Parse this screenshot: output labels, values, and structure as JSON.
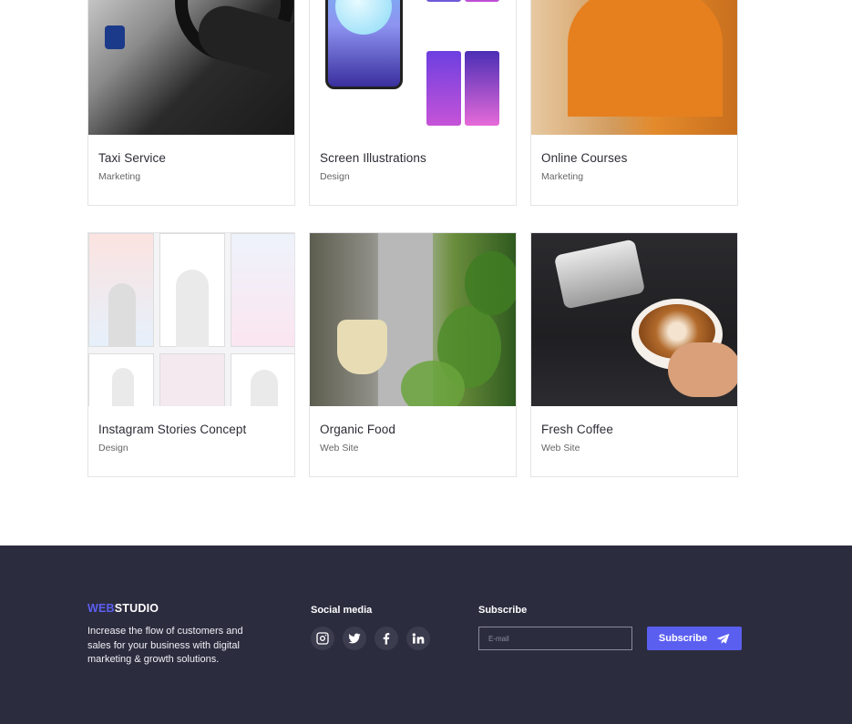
{
  "portfolio": {
    "items": [
      {
        "title": "Taxi Service",
        "category": "Marketing"
      },
      {
        "title": "Screen Illustrations",
        "category": "Design"
      },
      {
        "title": "Online Courses",
        "category": "Marketing"
      },
      {
        "title": "Instagram Stories Concept",
        "category": "Design"
      },
      {
        "title": "Organic Food",
        "category": "Web Site"
      },
      {
        "title": "Fresh Coffee",
        "category": "Web Site"
      }
    ]
  },
  "footer": {
    "brand_accent": "WEB",
    "brand_rest": "STUDIO",
    "description": "Increase the flow of customers and sales for your business with digital marketing & growth solutions.",
    "social_heading": "Social media",
    "social_icons": [
      "instagram-icon",
      "twitter-icon",
      "facebook-icon",
      "linkedin-icon"
    ],
    "subscribe_heading": "Subscribe",
    "email_placeholder": "E-mail",
    "subscribe_button": "Subscribe"
  },
  "colors": {
    "accent": "#5b5ff0",
    "footer_bg": "#2c2c3f"
  }
}
